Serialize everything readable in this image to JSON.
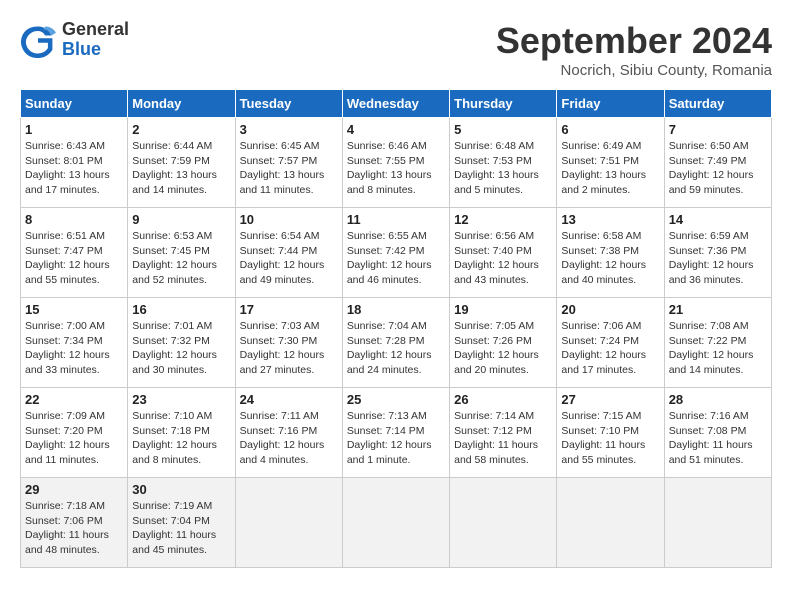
{
  "header": {
    "logo_general": "General",
    "logo_blue": "Blue",
    "month_title": "September 2024",
    "subtitle": "Nocrich, Sibiu County, Romania"
  },
  "weekdays": [
    "Sunday",
    "Monday",
    "Tuesday",
    "Wednesday",
    "Thursday",
    "Friday",
    "Saturday"
  ],
  "weeks": [
    [
      {
        "day": "1",
        "sunrise": "Sunrise: 6:43 AM",
        "sunset": "Sunset: 8:01 PM",
        "daylight": "Daylight: 13 hours and 17 minutes."
      },
      {
        "day": "2",
        "sunrise": "Sunrise: 6:44 AM",
        "sunset": "Sunset: 7:59 PM",
        "daylight": "Daylight: 13 hours and 14 minutes."
      },
      {
        "day": "3",
        "sunrise": "Sunrise: 6:45 AM",
        "sunset": "Sunset: 7:57 PM",
        "daylight": "Daylight: 13 hours and 11 minutes."
      },
      {
        "day": "4",
        "sunrise": "Sunrise: 6:46 AM",
        "sunset": "Sunset: 7:55 PM",
        "daylight": "Daylight: 13 hours and 8 minutes."
      },
      {
        "day": "5",
        "sunrise": "Sunrise: 6:48 AM",
        "sunset": "Sunset: 7:53 PM",
        "daylight": "Daylight: 13 hours and 5 minutes."
      },
      {
        "day": "6",
        "sunrise": "Sunrise: 6:49 AM",
        "sunset": "Sunset: 7:51 PM",
        "daylight": "Daylight: 13 hours and 2 minutes."
      },
      {
        "day": "7",
        "sunrise": "Sunrise: 6:50 AM",
        "sunset": "Sunset: 7:49 PM",
        "daylight": "Daylight: 12 hours and 59 minutes."
      }
    ],
    [
      {
        "day": "8",
        "sunrise": "Sunrise: 6:51 AM",
        "sunset": "Sunset: 7:47 PM",
        "daylight": "Daylight: 12 hours and 55 minutes."
      },
      {
        "day": "9",
        "sunrise": "Sunrise: 6:53 AM",
        "sunset": "Sunset: 7:45 PM",
        "daylight": "Daylight: 12 hours and 52 minutes."
      },
      {
        "day": "10",
        "sunrise": "Sunrise: 6:54 AM",
        "sunset": "Sunset: 7:44 PM",
        "daylight": "Daylight: 12 hours and 49 minutes."
      },
      {
        "day": "11",
        "sunrise": "Sunrise: 6:55 AM",
        "sunset": "Sunset: 7:42 PM",
        "daylight": "Daylight: 12 hours and 46 minutes."
      },
      {
        "day": "12",
        "sunrise": "Sunrise: 6:56 AM",
        "sunset": "Sunset: 7:40 PM",
        "daylight": "Daylight: 12 hours and 43 minutes."
      },
      {
        "day": "13",
        "sunrise": "Sunrise: 6:58 AM",
        "sunset": "Sunset: 7:38 PM",
        "daylight": "Daylight: 12 hours and 40 minutes."
      },
      {
        "day": "14",
        "sunrise": "Sunrise: 6:59 AM",
        "sunset": "Sunset: 7:36 PM",
        "daylight": "Daylight: 12 hours and 36 minutes."
      }
    ],
    [
      {
        "day": "15",
        "sunrise": "Sunrise: 7:00 AM",
        "sunset": "Sunset: 7:34 PM",
        "daylight": "Daylight: 12 hours and 33 minutes."
      },
      {
        "day": "16",
        "sunrise": "Sunrise: 7:01 AM",
        "sunset": "Sunset: 7:32 PM",
        "daylight": "Daylight: 12 hours and 30 minutes."
      },
      {
        "day": "17",
        "sunrise": "Sunrise: 7:03 AM",
        "sunset": "Sunset: 7:30 PM",
        "daylight": "Daylight: 12 hours and 27 minutes."
      },
      {
        "day": "18",
        "sunrise": "Sunrise: 7:04 AM",
        "sunset": "Sunset: 7:28 PM",
        "daylight": "Daylight: 12 hours and 24 minutes."
      },
      {
        "day": "19",
        "sunrise": "Sunrise: 7:05 AM",
        "sunset": "Sunset: 7:26 PM",
        "daylight": "Daylight: 12 hours and 20 minutes."
      },
      {
        "day": "20",
        "sunrise": "Sunrise: 7:06 AM",
        "sunset": "Sunset: 7:24 PM",
        "daylight": "Daylight: 12 hours and 17 minutes."
      },
      {
        "day": "21",
        "sunrise": "Sunrise: 7:08 AM",
        "sunset": "Sunset: 7:22 PM",
        "daylight": "Daylight: 12 hours and 14 minutes."
      }
    ],
    [
      {
        "day": "22",
        "sunrise": "Sunrise: 7:09 AM",
        "sunset": "Sunset: 7:20 PM",
        "daylight": "Daylight: 12 hours and 11 minutes."
      },
      {
        "day": "23",
        "sunrise": "Sunrise: 7:10 AM",
        "sunset": "Sunset: 7:18 PM",
        "daylight": "Daylight: 12 hours and 8 minutes."
      },
      {
        "day": "24",
        "sunrise": "Sunrise: 7:11 AM",
        "sunset": "Sunset: 7:16 PM",
        "daylight": "Daylight: 12 hours and 4 minutes."
      },
      {
        "day": "25",
        "sunrise": "Sunrise: 7:13 AM",
        "sunset": "Sunset: 7:14 PM",
        "daylight": "Daylight: 12 hours and 1 minute."
      },
      {
        "day": "26",
        "sunrise": "Sunrise: 7:14 AM",
        "sunset": "Sunset: 7:12 PM",
        "daylight": "Daylight: 11 hours and 58 minutes."
      },
      {
        "day": "27",
        "sunrise": "Sunrise: 7:15 AM",
        "sunset": "Sunset: 7:10 PM",
        "daylight": "Daylight: 11 hours and 55 minutes."
      },
      {
        "day": "28",
        "sunrise": "Sunrise: 7:16 AM",
        "sunset": "Sunset: 7:08 PM",
        "daylight": "Daylight: 11 hours and 51 minutes."
      }
    ],
    [
      {
        "day": "29",
        "sunrise": "Sunrise: 7:18 AM",
        "sunset": "Sunset: 7:06 PM",
        "daylight": "Daylight: 11 hours and 48 minutes."
      },
      {
        "day": "30",
        "sunrise": "Sunrise: 7:19 AM",
        "sunset": "Sunset: 7:04 PM",
        "daylight": "Daylight: 11 hours and 45 minutes."
      },
      null,
      null,
      null,
      null,
      null
    ]
  ]
}
